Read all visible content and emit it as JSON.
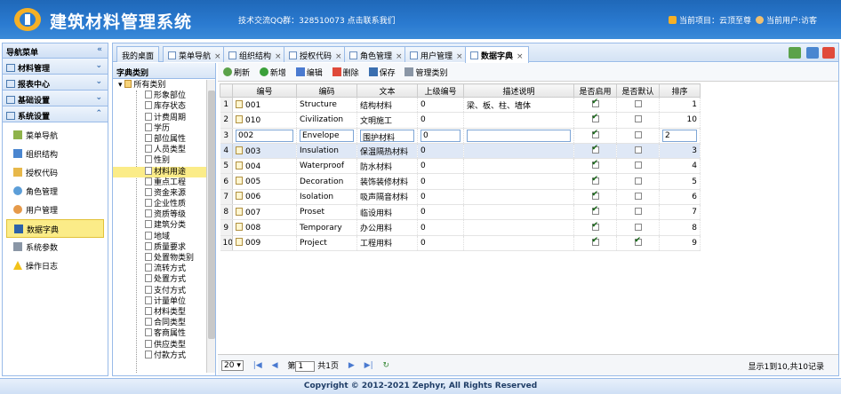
{
  "header": {
    "title": "建筑材料管理系统",
    "qq": "技术交流QQ群：328510073 点击联系我们",
    "project": "当前项目：云顶至尊",
    "user": "当前用户:访客"
  },
  "left": {
    "title": "导航菜单",
    "groups": [
      "材料管理",
      "报表中心",
      "基础设置",
      "系统设置"
    ],
    "menu": [
      {
        "label": "菜单导航",
        "icon": "menu-icon"
      },
      {
        "label": "组织结构",
        "icon": "org-icon"
      },
      {
        "label": "授权代码",
        "icon": "key-icon"
      },
      {
        "label": "角色管理",
        "icon": "role-icon"
      },
      {
        "label": "用户管理",
        "icon": "user-icon"
      },
      {
        "label": "数据字典",
        "icon": "book-icon"
      },
      {
        "label": "系统参数",
        "icon": "wrench-icon"
      },
      {
        "label": "操作日志",
        "icon": "warning-icon"
      }
    ]
  },
  "tabs": [
    "我的桌面",
    "菜单导航",
    "组织结构",
    "授权代码",
    "角色管理",
    "用户管理",
    "数据字典"
  ],
  "dict": {
    "title": "字典类别",
    "root": "所有类别",
    "items": [
      "形象部位",
      "库存状态",
      "计费周期",
      "学历",
      "部位属性",
      "人员类型",
      "性别",
      "材料用途",
      "重点工程",
      "资金来源",
      "企业性质",
      "资质等级",
      "建筑分类",
      "地域",
      "质量要求",
      "处置物类别",
      "流转方式",
      "处置方式",
      "支付方式",
      "计量单位",
      "材料类型",
      "合同类型",
      "客商属性",
      "供应类型",
      "付款方式"
    ]
  },
  "toolbar": {
    "refresh": "刷新",
    "add": "新增",
    "edit": "编辑",
    "delete": "删除",
    "save": "保存",
    "manage": "管理类别"
  },
  "grid": {
    "headers": [
      "编号",
      "编码",
      "文本",
      "上级编号",
      "描述说明",
      "是否启用",
      "是否默认",
      "排序"
    ],
    "rows": [
      {
        "n": "1",
        "id": "001",
        "code": "Structure",
        "text": "结构材料",
        "parent": "0",
        "desc": "梁、板、柱、墙体",
        "enabled": true,
        "default": false,
        "sort": "1"
      },
      {
        "n": "2",
        "id": "010",
        "code": "Civilization",
        "text": "文明施工",
        "parent": "0",
        "desc": "",
        "enabled": true,
        "default": false,
        "sort": "10"
      },
      {
        "n": "3",
        "id": "002",
        "code": "Envelope",
        "text": "围护材料",
        "parent": "0",
        "desc": "",
        "enabled": true,
        "default": false,
        "sort": "2"
      },
      {
        "n": "4",
        "id": "003",
        "code": "Insulation",
        "text": "保温隔热材料",
        "parent": "0",
        "desc": "",
        "enabled": true,
        "default": false,
        "sort": "3"
      },
      {
        "n": "5",
        "id": "004",
        "code": "Waterproof",
        "text": "防水材料",
        "parent": "0",
        "desc": "",
        "enabled": true,
        "default": false,
        "sort": "4"
      },
      {
        "n": "6",
        "id": "005",
        "code": "Decoration",
        "text": "装饰装修材料",
        "parent": "0",
        "desc": "",
        "enabled": true,
        "default": false,
        "sort": "5"
      },
      {
        "n": "7",
        "id": "006",
        "code": "Isolation",
        "text": "吸声隔音材料",
        "parent": "0",
        "desc": "",
        "enabled": true,
        "default": false,
        "sort": "6"
      },
      {
        "n": "8",
        "id": "007",
        "code": "Proset",
        "text": "临设用料",
        "parent": "0",
        "desc": "",
        "enabled": true,
        "default": false,
        "sort": "7"
      },
      {
        "n": "9",
        "id": "008",
        "code": "Temporary",
        "text": "办公用料",
        "parent": "0",
        "desc": "",
        "enabled": true,
        "default": false,
        "sort": "8"
      },
      {
        "n": "10",
        "id": "009",
        "code": "Project",
        "text": "工程用料",
        "parent": "0",
        "desc": "",
        "enabled": true,
        "default": true,
        "sort": "9"
      }
    ]
  },
  "pager": {
    "size": "20",
    "page": "1",
    "prefix": "第",
    "suffix": "共1页",
    "info": "显示1到10,共10记录"
  },
  "footer": "Copyright © 2012-2021 Zephyr, All Rights Reserved"
}
